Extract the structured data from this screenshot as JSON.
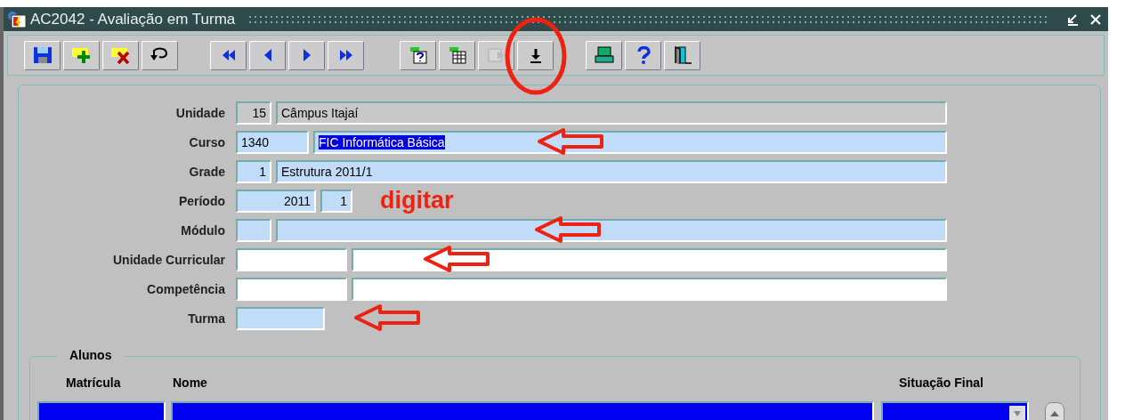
{
  "window": {
    "title": "AC2042 - Avaliação em Turma"
  },
  "toolbar": [
    {
      "buttons": [
        {
          "kind": "save",
          "disabled": false,
          "circled": false
        },
        {
          "kind": "insert",
          "disabled": false,
          "circled": false
        },
        {
          "kind": "delete",
          "disabled": false,
          "circled": false
        },
        {
          "kind": "undo",
          "disabled": false,
          "circled": false
        }
      ]
    },
    {
      "buttons": [
        {
          "kind": "first",
          "disabled": false,
          "circled": false
        },
        {
          "kind": "prev",
          "disabled": false,
          "circled": false
        },
        {
          "kind": "next",
          "disabled": false,
          "circled": false
        },
        {
          "kind": "last",
          "disabled": false,
          "circled": false
        }
      ]
    },
    {
      "buttons": [
        {
          "kind": "query",
          "disabled": false,
          "circled": false
        },
        {
          "kind": "table",
          "disabled": false,
          "circled": false
        },
        {
          "kind": "execute",
          "disabled": true,
          "circled": false
        },
        {
          "kind": "download",
          "disabled": false,
          "circled": true
        }
      ]
    },
    {
      "buttons": [
        {
          "kind": "print",
          "disabled": false,
          "circled": false
        },
        {
          "kind": "help",
          "disabled": false,
          "circled": false
        },
        {
          "kind": "exit",
          "disabled": false,
          "circled": false
        }
      ]
    }
  ],
  "form": {
    "rows": [
      {
        "label": "Unidade",
        "arrow": false,
        "fields": [
          {
            "kind": "code",
            "readonly": true,
            "value": "15",
            "selected": false
          },
          {
            "kind": "name",
            "readonly": true,
            "value": "Câmpus Itajaí",
            "selected": false
          }
        ]
      },
      {
        "label": "Curso",
        "arrow": true,
        "fields": [
          {
            "kind": "course",
            "readonly": false,
            "required": true,
            "value": "1340",
            "selected": false
          },
          {
            "kind": "name",
            "readonly": false,
            "required": true,
            "value": "FIC Informática Básica",
            "selected": true
          }
        ]
      },
      {
        "label": "Grade",
        "arrow": false,
        "fields": [
          {
            "kind": "code",
            "readonly": false,
            "required": true,
            "value": "1",
            "selected": false
          },
          {
            "kind": "name",
            "readonly": false,
            "required": true,
            "value": "Estrutura 2011/1",
            "selected": false
          }
        ]
      },
      {
        "label": "Período",
        "arrow": false,
        "note": "digitar",
        "fields": [
          {
            "kind": "year",
            "readonly": false,
            "required": true,
            "value": "2011",
            "selected": false
          },
          {
            "kind": "digit",
            "readonly": false,
            "required": true,
            "value": "1",
            "selected": false
          }
        ]
      },
      {
        "label": "Módulo",
        "arrow": true,
        "fields": [
          {
            "kind": "code",
            "readonly": false,
            "required": true
          },
          {
            "kind": "name",
            "readonly": false,
            "required": true
          }
        ]
      },
      {
        "label": "Unidade Curricular",
        "arrow": true,
        "fields": [
          {
            "kind": "medium",
            "readonly": false,
            "required": false
          },
          {
            "kind": "name",
            "readonly": false,
            "required": false
          }
        ]
      },
      {
        "label": "Competência",
        "arrow": false,
        "fields": [
          {
            "kind": "medium",
            "readonly": false,
            "required": false
          },
          {
            "kind": "name",
            "readonly": false,
            "required": false
          }
        ]
      },
      {
        "label": "Turma",
        "arrow": true,
        "fields": [
          {
            "kind": "wide",
            "readonly": false,
            "required": true
          }
        ]
      }
    ]
  },
  "students": {
    "title": "Alunos",
    "columns": [
      "Matrícula",
      "Nome",
      "Situação Final"
    ],
    "rows": [
      {
        "selected": true
      }
    ]
  }
}
